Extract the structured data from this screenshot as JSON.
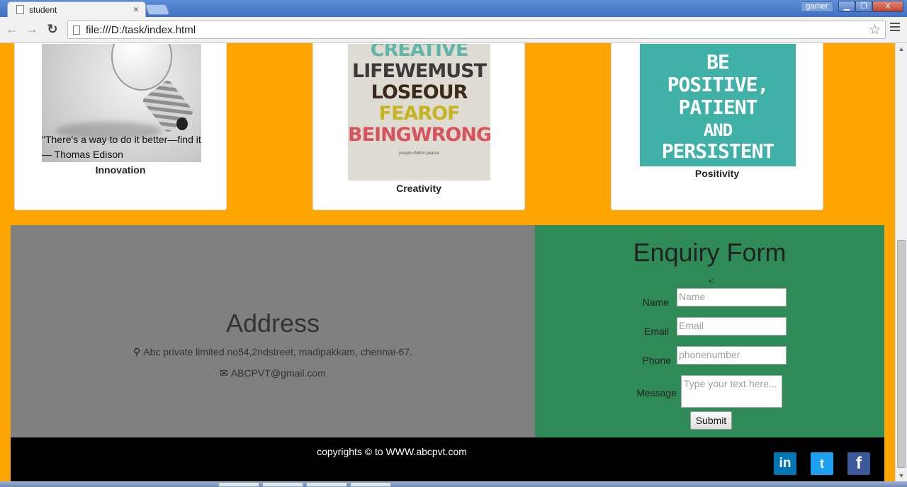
{
  "browser": {
    "tab_title": "student",
    "tab_close": "×",
    "url": "file:///D:/task/index.html",
    "user": "gamer",
    "min_symbol": "▁",
    "max_symbol": "❐",
    "close_symbol": "X",
    "back_symbol": "←",
    "forward_symbol": "→",
    "reload_symbol": "↻",
    "star_symbol": "☆"
  },
  "cards": [
    {
      "caption": "Innovation",
      "quote_line1": "\"There's a way to do it better—find it.\"",
      "quote_line2": "— Thomas Edison"
    },
    {
      "caption": "Creativity",
      "poster_lines": [
        "CREATIVE",
        "LIFEWEMUST",
        "LOSEOUR",
        "FEAROF",
        "BEINGWRONG"
      ],
      "poster_signature": "joseph chilton pearce"
    },
    {
      "caption": "Positivity",
      "poster_lines": [
        "BE",
        "POSITIVE,",
        "PATIENT",
        "AND",
        "PERSISTENT"
      ]
    }
  ],
  "address": {
    "title": "Address",
    "location": "Abc private limited no54,2ndstreet, madipakkam, chennai-67.",
    "email": "ABCPVT@gmail.com",
    "location_icon": "⚲",
    "email_icon": "✉"
  },
  "enquiry": {
    "title": "Enquiry Form",
    "stray": "<",
    "name_label": "Name",
    "name_placeholder": "Name",
    "email_label": "Email",
    "email_placeholder": "Email",
    "phone_label": "Phone",
    "phone_placeholder": "phonenumber",
    "message_label": "Message",
    "message_placeholder": "Type your text here...",
    "submit_label": "Submit"
  },
  "footer": {
    "copyright": "copyrights © to WWW.abcpvt.com",
    "linkedin": "in",
    "twitter": "t",
    "facebook": "f"
  },
  "colors": {
    "page_bg": "#ffa500",
    "address_bg": "#808080",
    "enquiry_bg": "#2e8b57",
    "footer_bg": "#000000"
  }
}
